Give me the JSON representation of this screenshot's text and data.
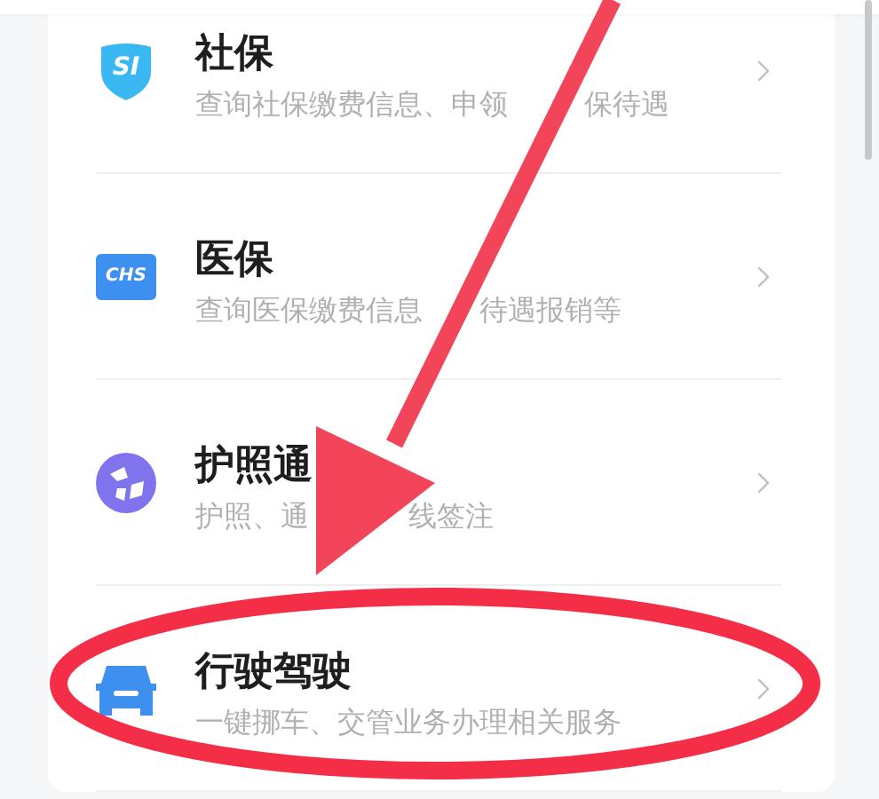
{
  "services": [
    {
      "kind": "shield",
      "icon_text": "SI",
      "title": "社保",
      "subtitle": [
        "查询社保缴费信息、申领",
        "保待遇"
      ]
    },
    {
      "kind": "card",
      "icon_text": "CHS",
      "title": "医保",
      "subtitle": [
        "查询医保缴费信息",
        "待遇报销等"
      ]
    },
    {
      "kind": "globe",
      "title": "护照通",
      "subtitle": [
        "护照、通",
        "线签注"
      ]
    },
    {
      "kind": "car",
      "title": "行驶驾驶",
      "subtitle": [
        "一键挪车、交管业务办理相关服务"
      ]
    }
  ]
}
